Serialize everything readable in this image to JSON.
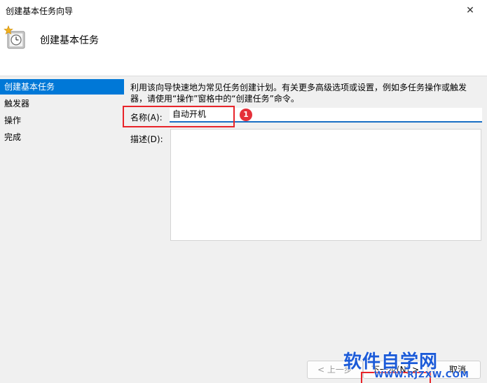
{
  "window": {
    "title": "创建基本任务向导",
    "close_glyph": "✕"
  },
  "header": {
    "title": "创建基本任务",
    "icon": "task-clock-icon"
  },
  "steps": [
    {
      "label": "创建基本任务",
      "active": true
    },
    {
      "label": "触发器",
      "active": false
    },
    {
      "label": "操作",
      "active": false
    },
    {
      "label": "完成",
      "active": false
    }
  ],
  "main": {
    "description": "利用该向导快速地为常见任务创建计划。有关更多高级选项或设置，例如多任务操作或触发器，请使用“操作”窗格中的“创建任务”命令。",
    "name_label": "名称(A):",
    "name_value": "自动开机",
    "desc_label": "描述(D):",
    "desc_value": ""
  },
  "annotation": {
    "badge": "1",
    "accent_color": "#e8242a"
  },
  "buttons": {
    "back": "< 上一步",
    "next": "下一步(N) >",
    "cancel": "取消"
  },
  "watermark": {
    "cn": "软件自学网",
    "en": "WWW.RJZXW.COM"
  },
  "colors": {
    "selected_step": "#0078d7",
    "input_focus": "#1a6fc4"
  }
}
